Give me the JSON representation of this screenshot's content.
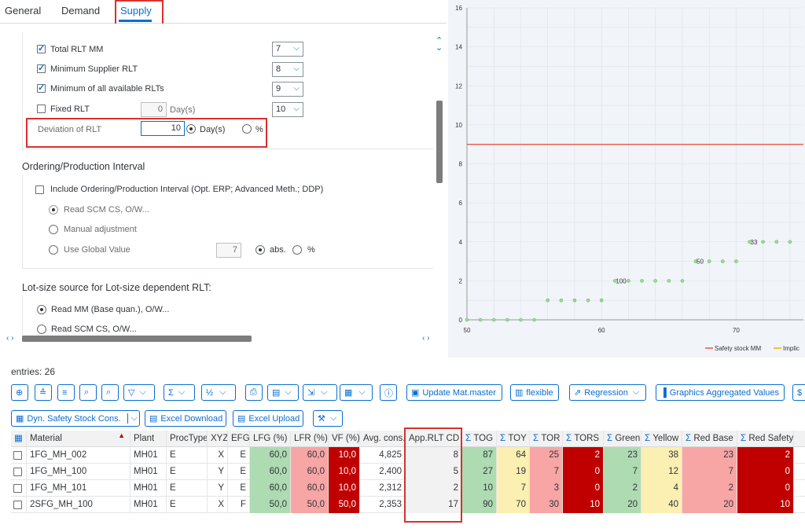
{
  "tabs": [
    {
      "label": "General"
    },
    {
      "label": "Demand"
    },
    {
      "label": "Supply"
    }
  ],
  "rlt": {
    "total_rlt_mm": {
      "label": "Total RLT MM",
      "value": "7"
    },
    "min_supplier": {
      "label": "Minimum Supplier RLT",
      "value": "8"
    },
    "min_all": {
      "label": "Minimum of all available RLTs",
      "value": "9"
    },
    "fixed": {
      "label": "Fixed RLT",
      "value": "0",
      "unit": "Day(s)",
      "select": "10"
    },
    "deviation": {
      "label": "Deviation of RLT",
      "value": "10",
      "unit_days": "Day(s)",
      "unit_pct": "%"
    }
  },
  "ordering": {
    "title": "Ordering/Production Interval",
    "include_label": "Include Ordering/Production Interval (Opt. ERP; Advanced Meth.; DDP)",
    "read_scm": "Read SCM CS, O/W...",
    "manual": "Manual adjustment",
    "global": "Use Global Value",
    "global_value": "7",
    "abs": "abs.",
    "pct": "%"
  },
  "lotsize": {
    "title": "Lot-size source for Lot-size dependent RLT:",
    "read_mm": "Read MM (Base quan.), O/W...",
    "read_scm": "Read SCM CS, O/W..."
  },
  "chart_data": {
    "type": "line",
    "xlim": [
      50,
      75
    ],
    "ylim": [
      0,
      16
    ],
    "x_ticks": [
      "50",
      "60",
      "70"
    ],
    "y_ticks": [
      "0",
      "2",
      "4",
      "6",
      "8",
      "10",
      "12",
      "14",
      "16"
    ],
    "legend": [
      "Safety stock MM",
      "Implic"
    ],
    "legend_colors": [
      "#e8594d",
      "#f0b400"
    ],
    "safety_stock_level": 9,
    "points": [
      [
        50,
        0
      ],
      [
        51,
        0
      ],
      [
        52,
        0
      ],
      [
        53,
        0
      ],
      [
        54,
        0
      ],
      [
        55,
        0
      ],
      [
        56,
        1
      ],
      [
        57,
        1
      ],
      [
        58,
        1
      ],
      [
        59,
        1
      ],
      [
        60,
        1
      ],
      [
        61,
        2
      ],
      [
        62,
        2
      ],
      [
        63,
        2
      ],
      [
        64,
        2
      ],
      [
        65,
        2
      ],
      [
        66,
        2
      ],
      [
        67,
        3
      ],
      [
        68,
        3
      ],
      [
        69,
        3
      ],
      [
        70,
        3
      ],
      [
        71,
        4
      ],
      [
        72,
        4
      ],
      [
        73,
        4
      ],
      [
        74,
        4
      ]
    ],
    "labels": [
      {
        "x": 61,
        "y": 2,
        "text": "100"
      },
      {
        "x": 67,
        "y": 3,
        "text": "50"
      },
      {
        "x": 71,
        "y": 4,
        "text": "33"
      }
    ]
  },
  "entries": "entries: 26",
  "toolbar": {
    "update": "Update Mat.master",
    "flexible": "flexible",
    "regression": "Regression",
    "graphics": "Graphics Aggregated Values",
    "dyn": "Dyn. Safety Stock Cons.",
    "excel_dl": "Excel Download",
    "excel_ul": "Excel Upload"
  },
  "table": {
    "headers": [
      "Material",
      "Plant",
      "ProcType",
      "XYZ",
      "EFG",
      "LFG (%)",
      "LFR (%)",
      "VF (%)",
      "Avg. cons.",
      "App.RLT CD",
      "TOG",
      "TOY",
      "TOR",
      "TORS",
      "Green",
      "Yellow",
      "Red Base",
      "Red Safety"
    ],
    "rows": [
      [
        "1FG_MH_002",
        "MH01",
        "E",
        "X",
        "E",
        "60,0",
        "60,0",
        "10,0",
        "4,825",
        "8",
        "87",
        "64",
        "25",
        "2",
        "23",
        "38",
        "23",
        "2"
      ],
      [
        "1FG_MH_100",
        "MH01",
        "E",
        "Y",
        "E",
        "60,0",
        "60,0",
        "10,0",
        "2,400",
        "5",
        "27",
        "19",
        "7",
        "0",
        "7",
        "12",
        "7",
        "0"
      ],
      [
        "1FG_MH_101",
        "MH01",
        "E",
        "Y",
        "E",
        "60,0",
        "60,0",
        "10,0",
        "2,312",
        "2",
        "10",
        "7",
        "3",
        "0",
        "2",
        "4",
        "2",
        "0"
      ],
      [
        "2SFG_MH_100",
        "MH01",
        "E",
        "X",
        "F",
        "50,0",
        "50,0",
        "50,0",
        "2,353",
        "17",
        "90",
        "70",
        "30",
        "10",
        "20",
        "40",
        "20",
        "10"
      ]
    ]
  }
}
